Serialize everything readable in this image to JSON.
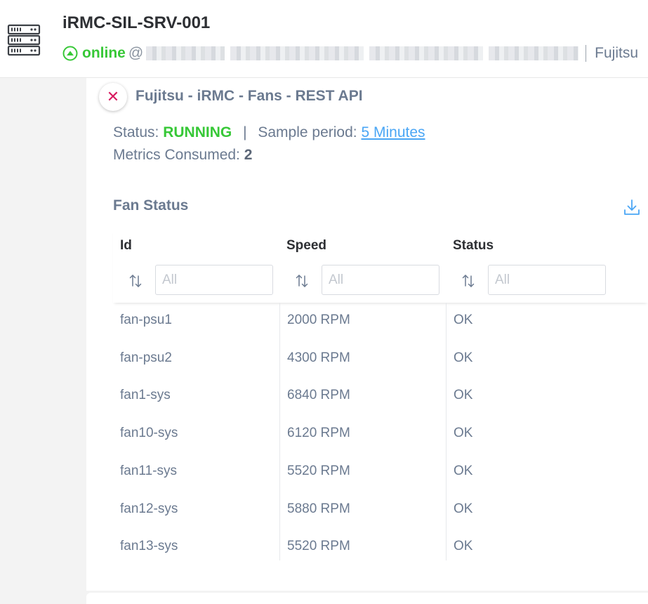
{
  "header": {
    "title": "iRMC-SIL-SRV-001",
    "status": "online",
    "at": "@",
    "vendor": "Fujitsu",
    "server_icon": "server-rack-icon",
    "status_icon": "online-up-icon"
  },
  "card": {
    "close_icon": "close-icon",
    "title": "Fujitsu - iRMC - Fans - REST API",
    "status_label": "Status:",
    "status_value": "RUNNING",
    "pipe": "|",
    "sample_period_label": "Sample period:",
    "sample_period_value": "5 Minutes",
    "metrics_label": "Metrics Consumed:",
    "metrics_value": "2"
  },
  "fan_status": {
    "title": "Fan Status",
    "download_icon": "download-icon",
    "columns": [
      {
        "label": "Id",
        "filter_placeholder": "All"
      },
      {
        "label": "Speed",
        "filter_placeholder": "All"
      },
      {
        "label": "Status",
        "filter_placeholder": "All"
      }
    ],
    "rows": [
      {
        "id": "fan-psu1",
        "speed": "2000 RPM",
        "status": "OK"
      },
      {
        "id": "fan-psu2",
        "speed": "4300 RPM",
        "status": "OK"
      },
      {
        "id": "fan1-sys",
        "speed": "6840 RPM",
        "status": "OK"
      },
      {
        "id": "fan10-sys",
        "speed": "6120 RPM",
        "status": "OK"
      },
      {
        "id": "fan11-sys",
        "speed": "5520 RPM",
        "status": "OK"
      },
      {
        "id": "fan12-sys",
        "speed": "5880 RPM",
        "status": "OK"
      },
      {
        "id": "fan13-sys",
        "speed": "5520 RPM",
        "status": "OK"
      }
    ]
  },
  "colors": {
    "online": "#37c837",
    "running": "#37c837",
    "link": "#4aa6f5",
    "close": "#d81b60",
    "text": "#6b7a90",
    "heading": "#2d2f33"
  }
}
